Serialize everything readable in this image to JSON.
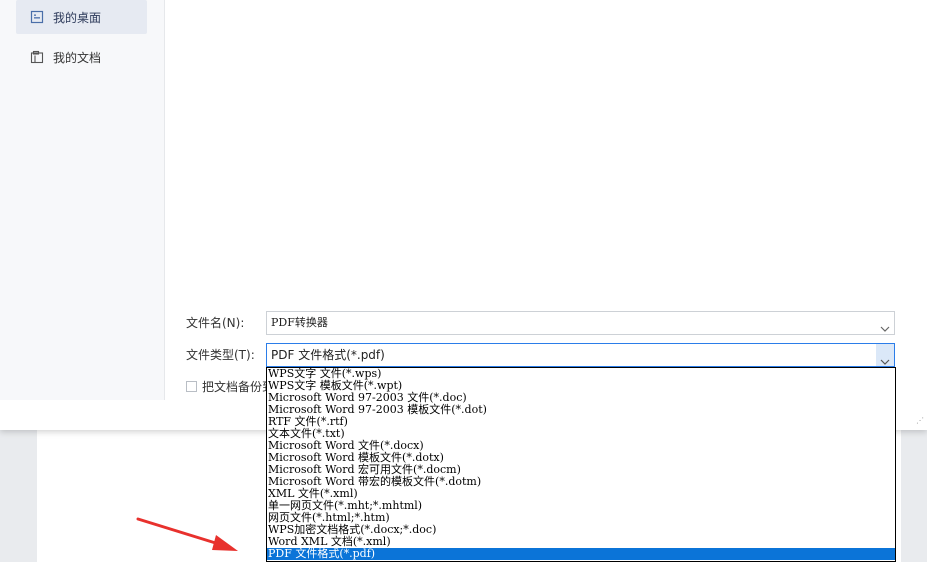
{
  "sidebar": {
    "items": [
      {
        "label": "我的桌面",
        "icon": "desktop-icon",
        "active": true
      },
      {
        "label": "我的文档",
        "icon": "folder-icon",
        "active": false
      }
    ]
  },
  "form": {
    "filename_label": "文件名(N):",
    "filename_value": "PDF转换器",
    "filetype_label": "文件类型(T):",
    "filetype_value": "PDF 文件格式(*.pdf)",
    "backup_checkbox_label": "把文档备份到"
  },
  "dropdown": {
    "options": [
      "WPS文字 文件(*.wps)",
      "WPS文字 模板文件(*.wpt)",
      "Microsoft Word 97-2003 文件(*.doc)",
      "Microsoft Word 97-2003 模板文件(*.dot)",
      "RTF 文件(*.rtf)",
      "文本文件(*.txt)",
      "Microsoft Word 文件(*.docx)",
      "Microsoft Word 模板文件(*.dotx)",
      "Microsoft Word 宏可用文件(*.docm)",
      "Microsoft Word 带宏的模板文件(*.dotm)",
      "XML 文件(*.xml)",
      "单一网页文件(*.mht;*.mhtml)",
      "网页文件(*.html;*.htm)",
      "WPS加密文档格式(*.docx;*.doc)",
      "Word XML 文档(*.xml)",
      "PDF 文件格式(*.pdf)"
    ],
    "selected_index": 15
  },
  "colors": {
    "accent": "#0b74d8",
    "annotation_arrow": "#e8312d"
  }
}
